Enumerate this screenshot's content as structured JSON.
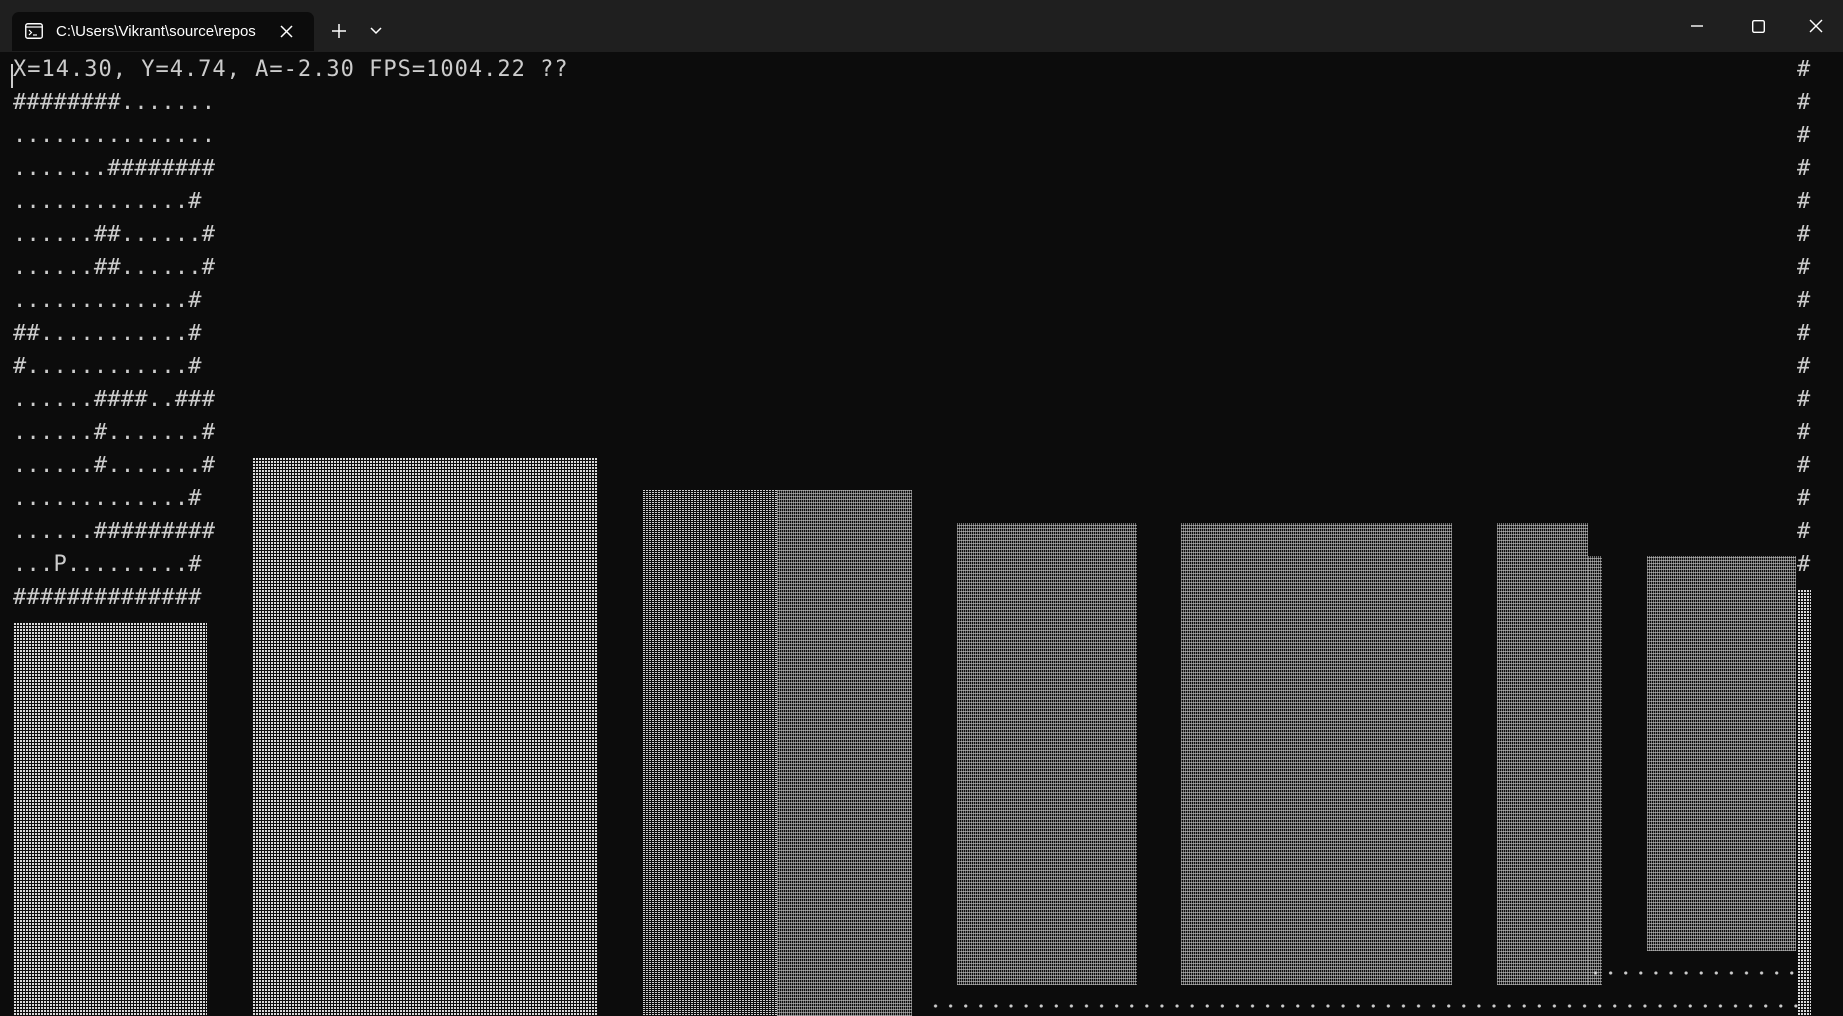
{
  "window": {
    "tab_title": "C:\\Users\\Vikrant\\source\\repos",
    "icons": {
      "tab": "terminal-icon",
      "close_tab": "close-icon",
      "new_tab": "plus-icon",
      "dropdown": "chevron-down-icon",
      "minimize": "minimize-icon",
      "maximize": "maximize-icon",
      "close_window": "close-icon"
    }
  },
  "console": {
    "status_line": "X=14.30, Y=4.74, A=-2.30 FPS=1004.22 ??",
    "map_rows": [
      "########.......",
      "...............",
      ".......########",
      ".............#",
      "......##......#",
      "......##......#",
      ".............#",
      "##...........#",
      "#............#",
      "......####..###",
      "......#.......#",
      "......#.......#",
      ".............#",
      "......#########",
      "...P.........#",
      "##############"
    ],
    "edge_char": "#",
    "colors": {
      "background": "#0c0c0c",
      "text": "#cccccc",
      "titlebar": "#1f1f1f"
    }
  }
}
